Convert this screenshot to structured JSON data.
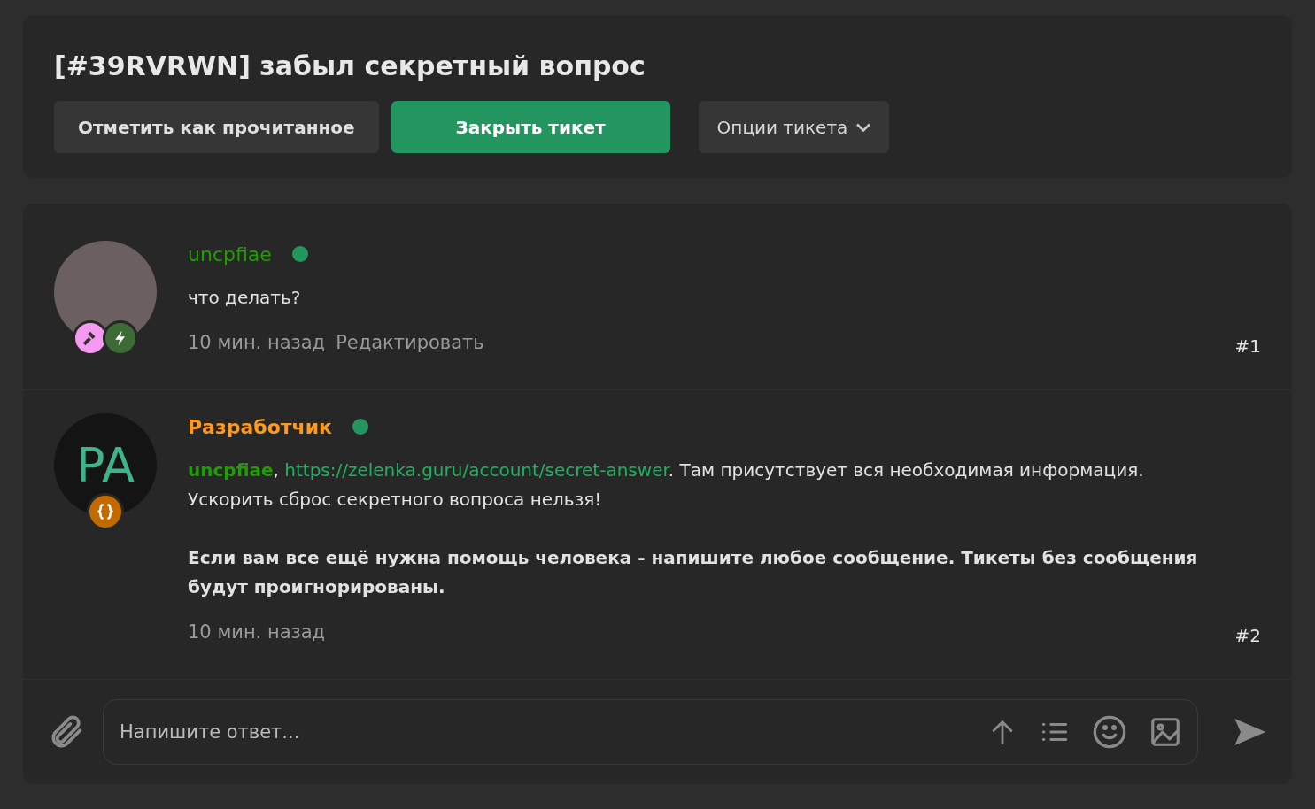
{
  "ticket": {
    "title": "[#39RVRWN] забыл секретный вопрос"
  },
  "actions": [
    {
      "label": "Отметить как прочитанное",
      "kind": "secondary"
    },
    {
      "label": "Закрыть тикет",
      "kind": "primary"
    },
    {
      "label": "Опции тикета",
      "kind": "dropdown"
    }
  ],
  "messages": [
    {
      "avatar": {
        "kind": "photo"
      },
      "badges": [
        {
          "kind": "hammer"
        },
        {
          "kind": "bolt"
        }
      ],
      "author": "uncpfiae",
      "color": "#1f9e00",
      "online": true,
      "paragraphs": [
        {
          "bold": false,
          "parts": [
            {
              "kind": "text",
              "text": "что делать?"
            }
          ]
        }
      ],
      "time": "10 мин. назад",
      "edit": "Редактировать",
      "number": "#1"
    },
    {
      "avatar": {
        "kind": "initials",
        "text": "PA"
      },
      "badges": [
        {
          "kind": "code"
        }
      ],
      "author": "Разработчик",
      "color": "#ff9a1f",
      "online": true,
      "paragraphs": [
        {
          "bold": false,
          "parts": [
            {
              "kind": "mention",
              "text": "uncpfiae"
            },
            {
              "kind": "text",
              "text": ", "
            },
            {
              "kind": "link",
              "text": "https://zelenka.guru/account/secret-answer"
            },
            {
              "kind": "text",
              "text": ". Там присутствует вся необходимая информация.\nУскорить сброс секретного вопроса нельзя!"
            }
          ]
        },
        {
          "bold": true,
          "parts": [
            {
              "kind": "text",
              "text": "Если вам все ещё нужна помощь человека - напишите любое сообщение. Тикеты без сообщения будут проигнорированы."
            }
          ]
        }
      ],
      "time": "10 мин. назад",
      "number": "#2"
    }
  ],
  "reply": {
    "placeholder": "Напишите ответ..."
  }
}
